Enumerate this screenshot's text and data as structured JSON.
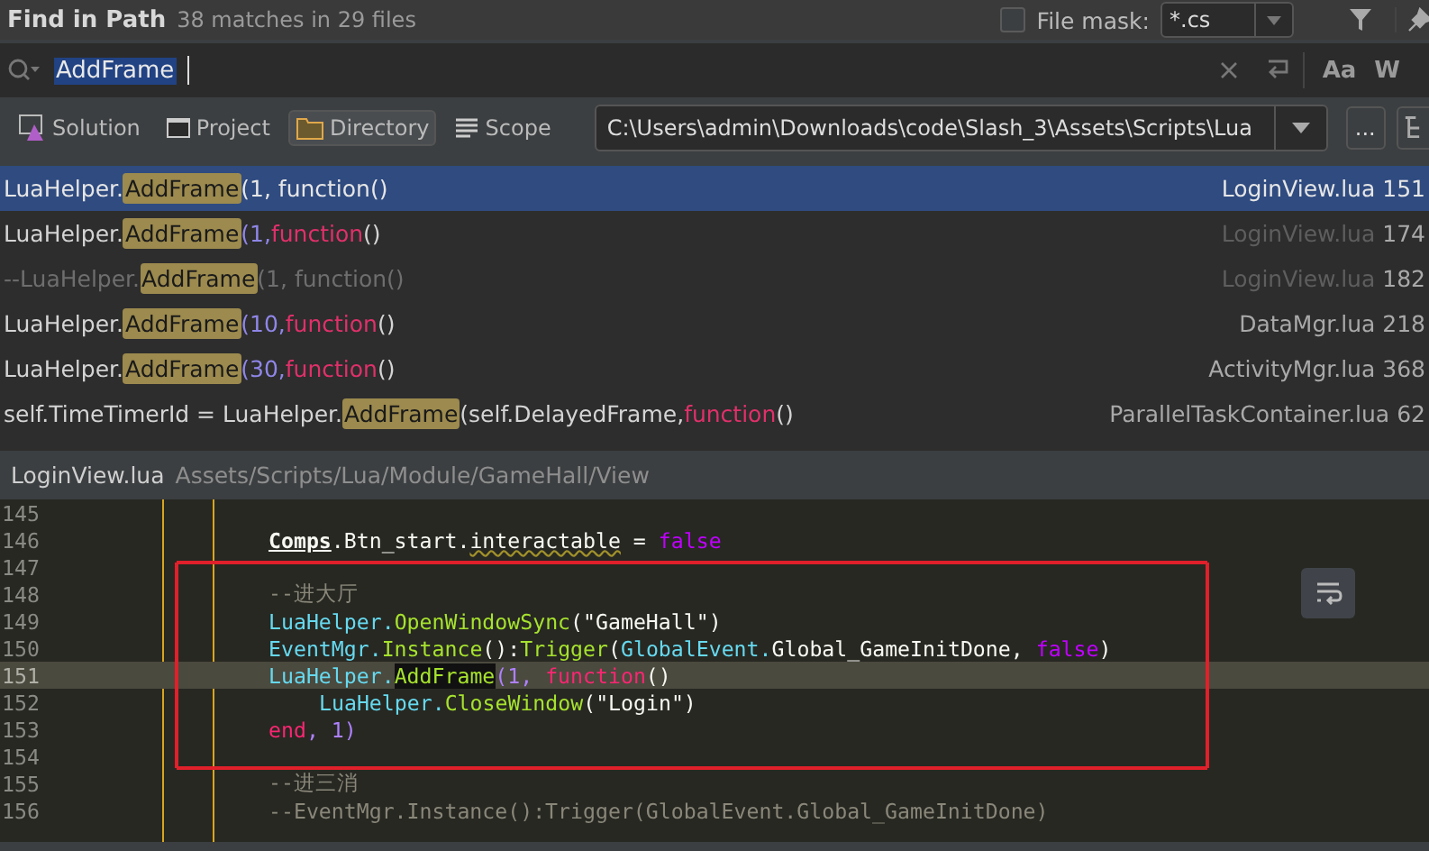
{
  "header": {
    "title": "Find in Path",
    "summary": "38 matches in 29 files",
    "file_mask": {
      "checked": false,
      "label": "File mask:",
      "value": "*.cs"
    }
  },
  "search": {
    "value": "AddFrame",
    "toggles": [
      "Aa",
      "W"
    ]
  },
  "scopes": [
    {
      "label": "Solution",
      "kind": "solution",
      "selected": false
    },
    {
      "label": "Project",
      "kind": "project",
      "selected": false
    },
    {
      "label": "Directory",
      "kind": "directory",
      "selected": true
    },
    {
      "label": "Scope",
      "kind": "scope",
      "selected": false
    }
  ],
  "directory": {
    "value": "C:\\Users\\admin\\Downloads\\code\\Slash_3\\Assets\\Scripts\\Lua",
    "browse": "..."
  },
  "results": [
    {
      "selected": true,
      "dimmed": false,
      "before": [
        {
          "text": "LuaHelper.",
          "kind": "plain"
        }
      ],
      "match": "AddFrame",
      "after": [
        {
          "text": "(1, function()",
          "kind": "plain"
        }
      ],
      "file": "LoginView.lua",
      "line": "151"
    },
    {
      "selected": false,
      "dimmed": true,
      "before": [
        {
          "text": "LuaHelper.",
          "kind": "plain"
        }
      ],
      "match": "AddFrame",
      "after": [
        {
          "text": "(1, ",
          "kind": "number"
        },
        {
          "text": "function",
          "kind": "keyword"
        },
        {
          "text": "()",
          "kind": "plain"
        }
      ],
      "file": "LoginView.lua",
      "line": "174"
    },
    {
      "selected": false,
      "dimmed": true,
      "before": [
        {
          "text": "--LuaHelper.",
          "kind": "comment"
        }
      ],
      "match": "AddFrame",
      "after": [
        {
          "text": "(1, function()",
          "kind": "comment"
        }
      ],
      "file": "LoginView.lua",
      "line": "182"
    },
    {
      "selected": false,
      "dimmed": false,
      "before": [
        {
          "text": "LuaHelper.",
          "kind": "plain"
        }
      ],
      "match": "AddFrame",
      "after": [
        {
          "text": "(10, ",
          "kind": "number"
        },
        {
          "text": "function",
          "kind": "keyword"
        },
        {
          "text": "()",
          "kind": "plain"
        }
      ],
      "file": "DataMgr.lua",
      "line": "218"
    },
    {
      "selected": false,
      "dimmed": false,
      "before": [
        {
          "text": "LuaHelper.",
          "kind": "plain"
        }
      ],
      "match": "AddFrame",
      "after": [
        {
          "text": "(30, ",
          "kind": "number"
        },
        {
          "text": "function",
          "kind": "keyword"
        },
        {
          "text": "()",
          "kind": "plain"
        }
      ],
      "file": "ActivityMgr.lua",
      "line": "368"
    },
    {
      "selected": false,
      "dimmed": false,
      "before": [
        {
          "text": "self.TimeTimerId = LuaHelper.",
          "kind": "plain"
        }
      ],
      "match": "AddFrame",
      "after": [
        {
          "text": "(self.DelayedFrame, ",
          "kind": "plain"
        },
        {
          "text": "function",
          "kind": "keyword"
        },
        {
          "text": "()",
          "kind": "plain"
        }
      ],
      "file": "ParallelTaskContainer.lua",
      "line": "62"
    }
  ],
  "preview": {
    "file": "LoginView.lua",
    "path": "Assets/Scripts/Lua/Module/GameHall/View"
  },
  "code_lines": [
    {
      "number": "145",
      "current": false,
      "boxed": false
    },
    {
      "number": "146",
      "current": false,
      "boxed": false,
      "tokens": [
        {
          "text": "Comps",
          "kind": "global"
        },
        {
          "text": ".Btn_start.",
          "kind": "plain"
        },
        {
          "text": "interactable",
          "kind": "warn"
        },
        {
          "text": " = ",
          "kind": "plain"
        },
        {
          "text": "false",
          "kind": "bool"
        }
      ]
    },
    {
      "number": "147",
      "current": false,
      "boxed": true
    },
    {
      "number": "148",
      "current": false,
      "boxed": true,
      "tokens": [
        {
          "text": "--进大厅",
          "kind": "comment"
        }
      ]
    },
    {
      "number": "149",
      "current": false,
      "boxed": true,
      "tokens": [
        {
          "text": "LuaHelper.",
          "kind": "ident"
        },
        {
          "text": "OpenWindowSync",
          "kind": "method"
        },
        {
          "text": "(\"GameHall\")",
          "kind": "plain"
        }
      ]
    },
    {
      "number": "150",
      "current": false,
      "boxed": true,
      "tokens": [
        {
          "text": "EventMgr.",
          "kind": "ident"
        },
        {
          "text": "Instance",
          "kind": "method"
        },
        {
          "text": "():",
          "kind": "plain"
        },
        {
          "text": "Trigger",
          "kind": "method"
        },
        {
          "text": "(",
          "kind": "plain"
        },
        {
          "text": "GlobalEvent.",
          "kind": "ident"
        },
        {
          "text": "Global_GameInitDone, ",
          "kind": "plain"
        },
        {
          "text": "false",
          "kind": "bool"
        },
        {
          "text": ")",
          "kind": "plain"
        }
      ]
    },
    {
      "number": "151",
      "current": true,
      "boxed": true,
      "tokens": [
        {
          "text": "LuaHelper.",
          "kind": "ident"
        },
        {
          "text": "AddFrame",
          "kind": "match"
        },
        {
          "text": "(1, ",
          "kind": "number"
        },
        {
          "text": "function",
          "kind": "keyword"
        },
        {
          "text": "()",
          "kind": "plain"
        }
      ],
      "children": [
        {
          "number": "152",
          "current": false,
          "boxed": true,
          "tokens": [
            {
              "text": "LuaHelper.",
              "kind": "ident"
            },
            {
              "text": "CloseWindow",
              "kind": "method"
            },
            {
              "text": "(\"Login\")",
              "kind": "plain"
            }
          ]
        }
      ]
    },
    {
      "number": "153",
      "current": false,
      "boxed": true,
      "tokens": [
        {
          "text": "end",
          "kind": "keyword"
        },
        {
          "text": ", 1)",
          "kind": "number"
        }
      ]
    },
    {
      "number": "154",
      "current": false,
      "boxed": true
    },
    {
      "number": "155",
      "current": false,
      "boxed": false,
      "tokens": [
        {
          "text": "--进三消",
          "kind": "comment"
        }
      ]
    },
    {
      "number": "156",
      "current": false,
      "boxed": false,
      "tokens": [
        {
          "text": "--EventMgr.Instance():Trigger(GlobalEvent.Global_GameInitDone)",
          "kind": "comment"
        }
      ]
    }
  ]
}
